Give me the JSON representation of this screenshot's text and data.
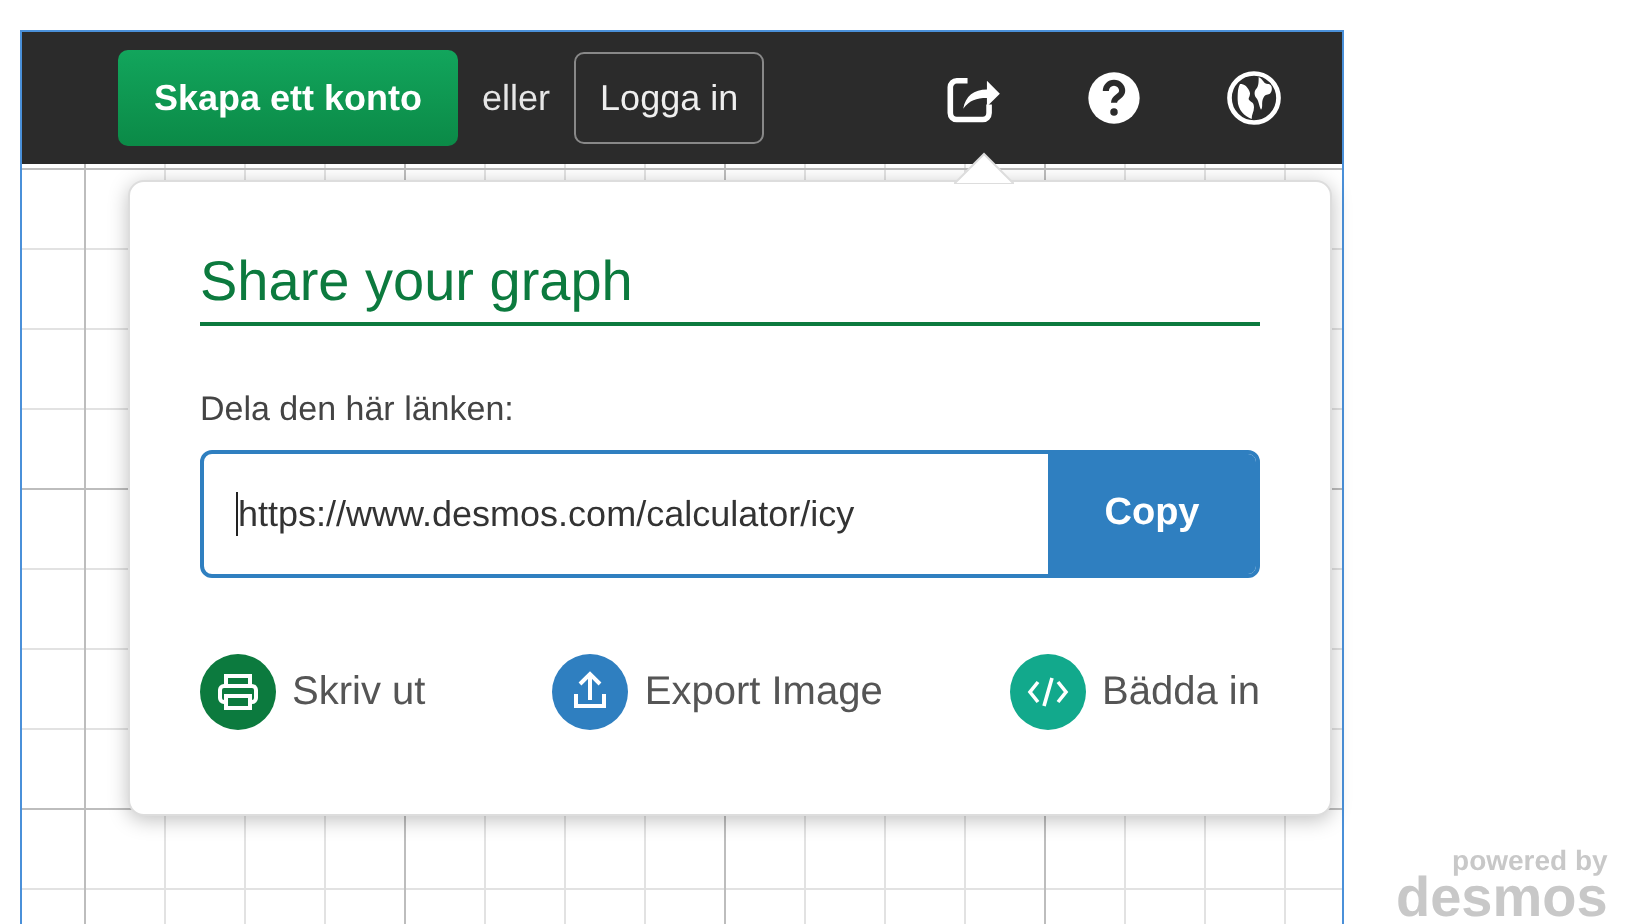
{
  "top_bar": {
    "signup_button": "Skapa ett konto",
    "or_text": "eller",
    "login_button": "Logga in"
  },
  "share_panel": {
    "title": "Share your graph",
    "link_label": "Dela den här länken:",
    "link_value": "https://www.desmos.com/calculator/icy",
    "copy_button": "Copy",
    "actions": [
      {
        "label": "Skriv ut",
        "kind": "print",
        "color": "#0c7a3e"
      },
      {
        "label": "Export Image",
        "kind": "export",
        "color": "#2f7fc0"
      },
      {
        "label": "Bädda in",
        "kind": "embed",
        "color": "#12a98c"
      }
    ]
  },
  "branding": {
    "tagline": "powered by",
    "name": "desmos"
  }
}
